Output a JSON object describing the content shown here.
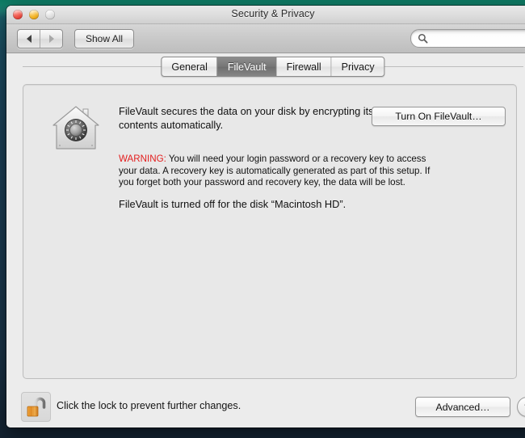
{
  "window": {
    "title": "Security & Privacy",
    "traffic_lights": [
      "close-button",
      "minimize-button",
      "zoom-button"
    ]
  },
  "toolbar": {
    "back_label": "back-arrow",
    "forward_label": "forward-arrow",
    "show_all_label": "Show All",
    "search": {
      "value": "",
      "placeholder": ""
    }
  },
  "tabs": [
    {
      "label": "General",
      "selected": false
    },
    {
      "label": "FileVault",
      "selected": true
    },
    {
      "label": "Firewall",
      "selected": false
    },
    {
      "label": "Privacy",
      "selected": false
    }
  ],
  "filevault": {
    "icon_name": "filevault-house-safe-icon",
    "description": "FileVault secures the data on your disk by encrypting its contents automatically.",
    "warning_flag": "WARNING:",
    "warning_text": " You will need your login password or a recovery key to access your data. A recovery key is automatically generated as part of this setup. If you forget both your password and recovery key, the data will be lost.",
    "status": "FileVault is turned off for the disk “Macintosh HD”.",
    "turn_on_button": "Turn On FileVault…"
  },
  "bottom_bar": {
    "lock_icon_name": "unlocked-padlock-icon",
    "lock_caption": "Click the lock to prevent further changes.",
    "advanced_button": "Advanced…",
    "help_button": "?"
  },
  "colors": {
    "warning_red": "#e31d1d",
    "selected_tab_gray": "#767676",
    "window_chrome": "#ececec",
    "panel_fill": "#e8e8e8"
  }
}
